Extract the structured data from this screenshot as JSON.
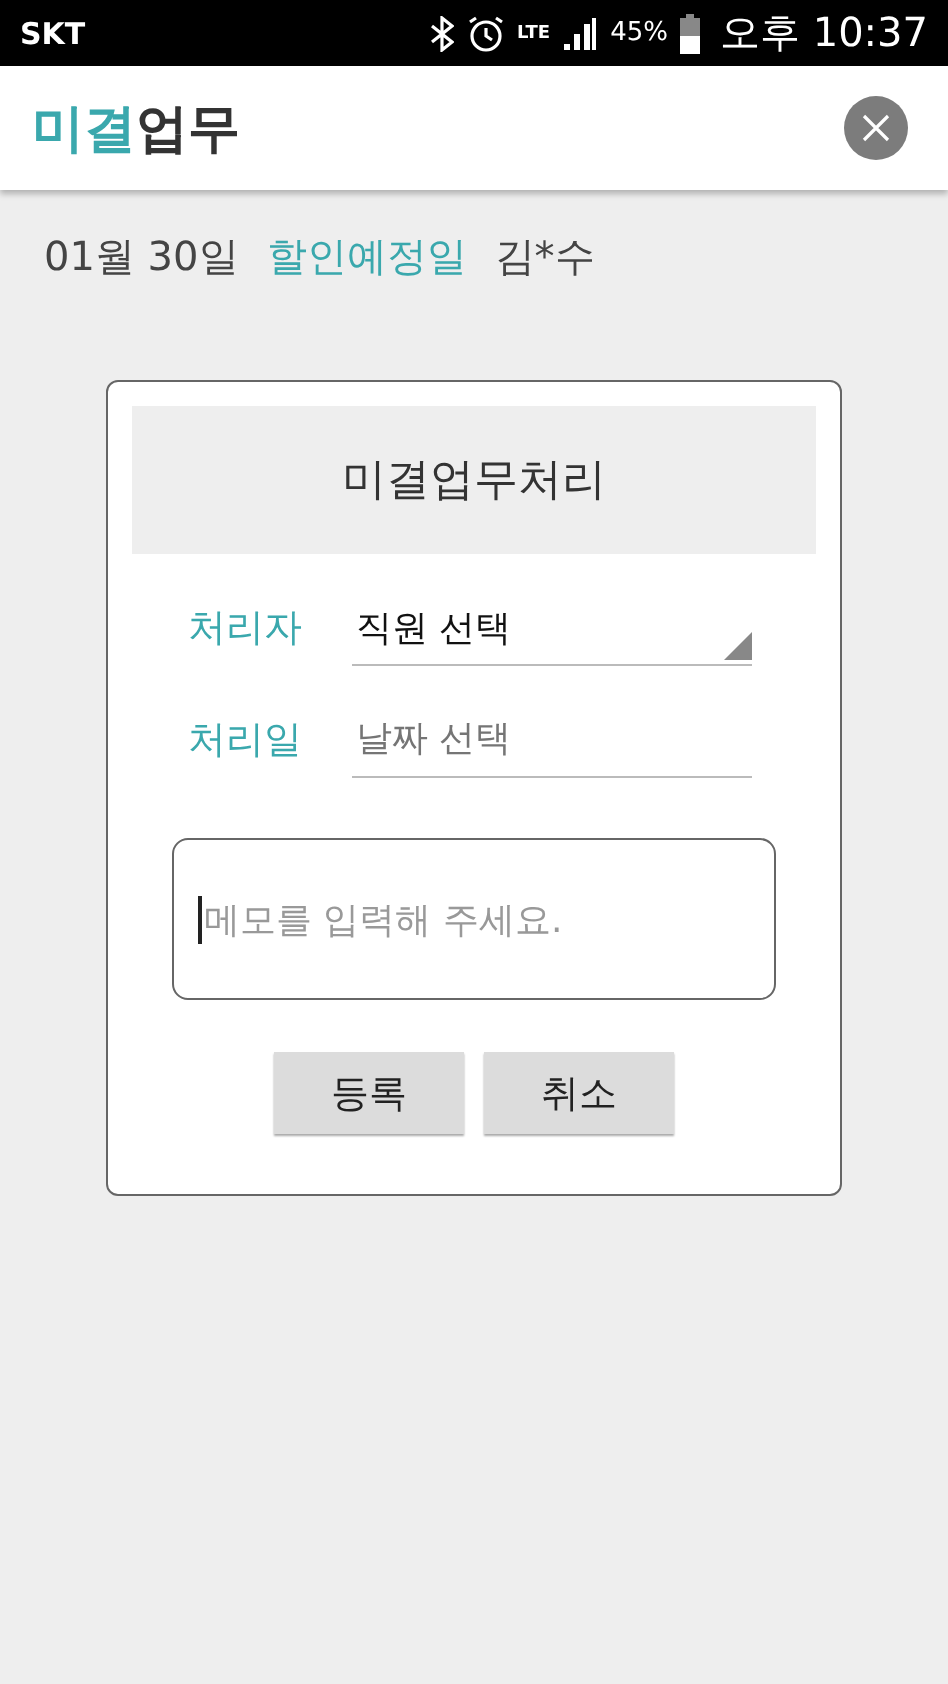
{
  "status_bar": {
    "carrier": "SKT",
    "network": "LTE",
    "battery": "45%",
    "time": "오후 10:37"
  },
  "app_bar": {
    "title_parts": [
      {
        "text": "미결",
        "accent": true
      },
      {
        "text": "업무",
        "accent": false
      }
    ]
  },
  "info": {
    "date": "01월 30일",
    "type": "할인예정일",
    "name": "김*수"
  },
  "dialog": {
    "title": "미결업무처리",
    "fields": [
      {
        "kind": "dropdown",
        "label": "처리자",
        "value": "직원 선택"
      },
      {
        "kind": "date",
        "label": "처리일",
        "placeholder": "날짜 선택"
      }
    ],
    "memo": {
      "placeholder": "메모를 입력해 주세요.",
      "focused": true
    },
    "buttons": [
      "등록",
      "취소"
    ]
  }
}
